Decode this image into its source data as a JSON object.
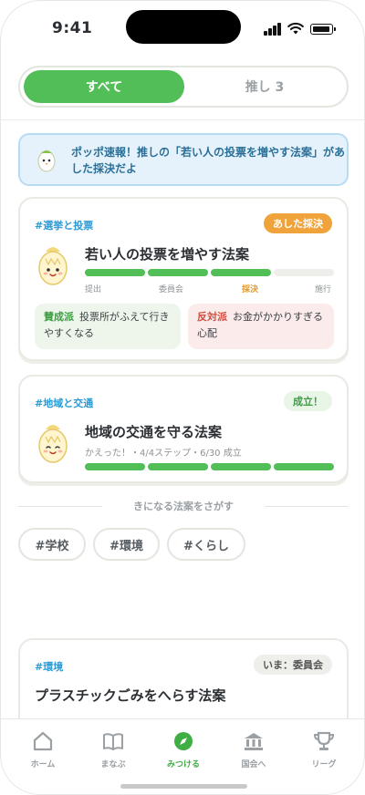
{
  "status": {
    "time": "9:41"
  },
  "tabs": [
    {
      "label": "すべて"
    },
    {
      "label": "推し 3"
    }
  ],
  "banner": {
    "text": "ポッポ速報！推しの「若い人の投票を増やす法案」があした採決だよ"
  },
  "cards": [
    {
      "tag": "#選挙と投票",
      "badge": "あした採決",
      "title": "若い人の投票を増やす法案",
      "steps": [
        "提出",
        "委員会",
        "採決",
        "施行"
      ],
      "progress_steps_done": 3,
      "pro": {
        "label": "賛成派",
        "text": "投票所がふえて行きやすくなる"
      },
      "con": {
        "label": "反対派",
        "text": "お金がかかりすぎる心配"
      }
    },
    {
      "tag": "#地域と交通",
      "badge": "成立！",
      "title": "地域の交通を守る法案",
      "subtext": "かえった！・4/4ステップ・6/30 成立",
      "progress_steps_done": 4
    },
    {
      "tag": "#環境",
      "badge": "いま：委員会",
      "title": "プラスチックごみをへらす法案"
    }
  ],
  "search": {
    "heading": "きになる法案をさがす",
    "chips": [
      "#学校",
      "#環境",
      "#くらし"
    ]
  },
  "nav": [
    {
      "label": "ホーム",
      "icon": "home-icon"
    },
    {
      "label": "まなぶ",
      "icon": "book-icon"
    },
    {
      "label": "みつける",
      "icon": "compass-icon",
      "active": true
    },
    {
      "label": "国会へ",
      "icon": "parliament-icon"
    },
    {
      "label": "リーグ",
      "icon": "trophy-icon"
    }
  ],
  "colors": {
    "accent": "#52be57",
    "tag": "#2b9bd6",
    "orange": "#f0a33a"
  }
}
